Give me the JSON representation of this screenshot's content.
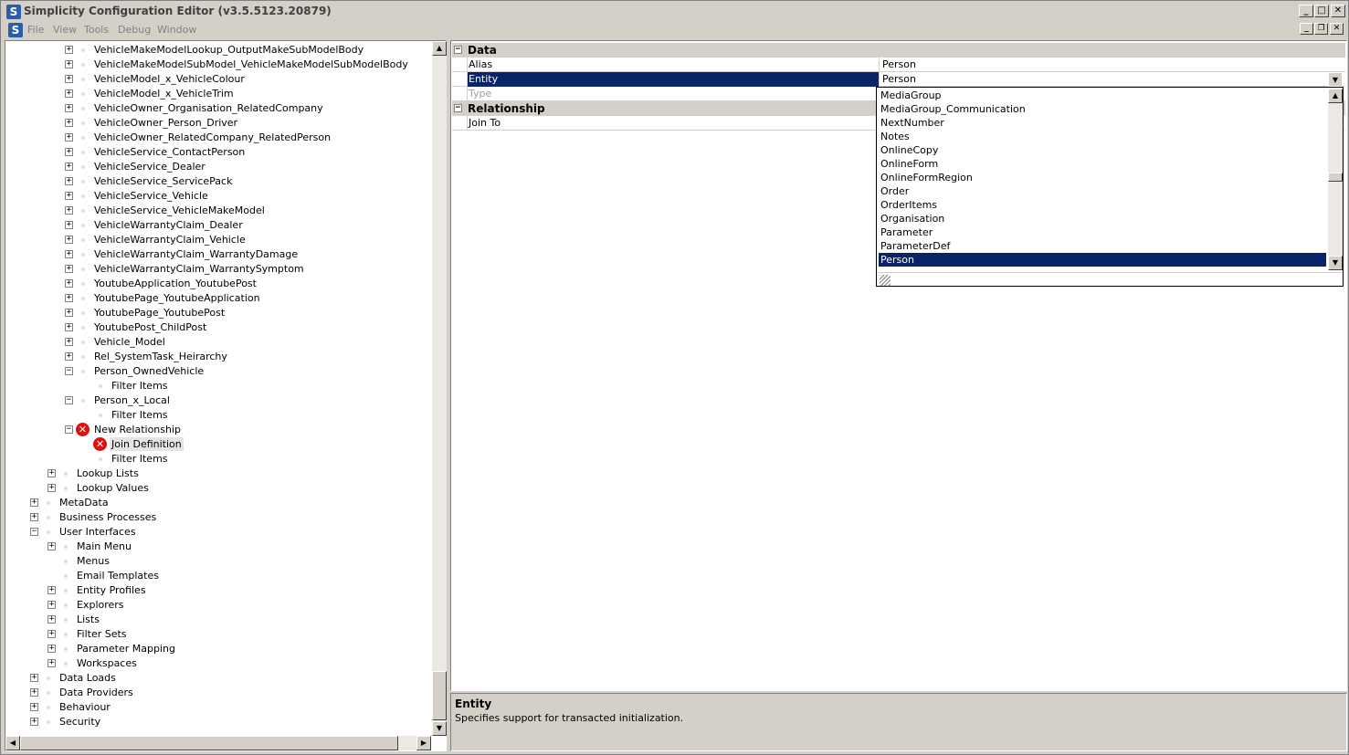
{
  "window": {
    "title": "Simplicity Configuration Editor (v3.5.5123.20879)",
    "app_icon_letter": "S"
  },
  "menu": {
    "items": [
      "File",
      "View",
      "Tools",
      "Debug",
      "Window"
    ]
  },
  "tree": {
    "nodes": [
      {
        "label": "VehicleMakeModelLookup_OutputMakeSubModelBody",
        "level": 3,
        "expander": "+",
        "icon": "dot"
      },
      {
        "label": "VehicleMakeModelSubModel_VehicleMakeModelSubModelBody",
        "level": 3,
        "expander": "+",
        "icon": "dot"
      },
      {
        "label": "VehicleModel_x_VehicleColour",
        "level": 3,
        "expander": "+",
        "icon": "dot"
      },
      {
        "label": "VehicleModel_x_VehicleTrim",
        "level": 3,
        "expander": "+",
        "icon": "dot"
      },
      {
        "label": "VehicleOwner_Organisation_RelatedCompany",
        "level": 3,
        "expander": "+",
        "icon": "dot"
      },
      {
        "label": "VehicleOwner_Person_Driver",
        "level": 3,
        "expander": "+",
        "icon": "dot"
      },
      {
        "label": "VehicleOwner_RelatedCompany_RelatedPerson",
        "level": 3,
        "expander": "+",
        "icon": "dot"
      },
      {
        "label": "VehicleService_ContactPerson",
        "level": 3,
        "expander": "+",
        "icon": "dot"
      },
      {
        "label": "VehicleService_Dealer",
        "level": 3,
        "expander": "+",
        "icon": "dot"
      },
      {
        "label": "VehicleService_ServicePack",
        "level": 3,
        "expander": "+",
        "icon": "dot"
      },
      {
        "label": "VehicleService_Vehicle",
        "level": 3,
        "expander": "+",
        "icon": "dot"
      },
      {
        "label": "VehicleService_VehicleMakeModel",
        "level": 3,
        "expander": "+",
        "icon": "dot"
      },
      {
        "label": "VehicleWarrantyClaim_Dealer",
        "level": 3,
        "expander": "+",
        "icon": "dot"
      },
      {
        "label": "VehicleWarrantyClaim_Vehicle",
        "level": 3,
        "expander": "+",
        "icon": "dot"
      },
      {
        "label": "VehicleWarrantyClaim_WarrantyDamage",
        "level": 3,
        "expander": "+",
        "icon": "dot"
      },
      {
        "label": "VehicleWarrantyClaim_WarrantySymptom",
        "level": 3,
        "expander": "+",
        "icon": "dot"
      },
      {
        "label": "YoutubeApplication_YoutubePost",
        "level": 3,
        "expander": "+",
        "icon": "dot"
      },
      {
        "label": "YoutubePage_YoutubeApplication",
        "level": 3,
        "expander": "+",
        "icon": "dot"
      },
      {
        "label": "YoutubePage_YoutubePost",
        "level": 3,
        "expander": "+",
        "icon": "dot"
      },
      {
        "label": "YoutubePost_ChildPost",
        "level": 3,
        "expander": "+",
        "icon": "dot"
      },
      {
        "label": "Vehicle_Model",
        "level": 3,
        "expander": "+",
        "icon": "dot"
      },
      {
        "label": "Rel_SystemTask_Heirarchy",
        "level": 3,
        "expander": "+",
        "icon": "dot"
      },
      {
        "label": "Person_OwnedVehicle",
        "level": 3,
        "expander": "-",
        "icon": "dot"
      },
      {
        "label": "Filter Items",
        "level": 4,
        "expander": "",
        "icon": "dot"
      },
      {
        "label": "Person_x_Local",
        "level": 3,
        "expander": "-",
        "icon": "dot"
      },
      {
        "label": "Filter Items",
        "level": 4,
        "expander": "",
        "icon": "dot"
      },
      {
        "label": "New Relationship",
        "level": 3,
        "expander": "-",
        "icon": "error"
      },
      {
        "label": "Join Definition",
        "level": 4,
        "expander": "",
        "icon": "error",
        "selected": true
      },
      {
        "label": "Filter Items",
        "level": 4,
        "expander": "",
        "icon": "dot"
      },
      {
        "label": "Lookup Lists",
        "level": 2,
        "expander": "+",
        "icon": "dot"
      },
      {
        "label": "Lookup Values",
        "level": 2,
        "expander": "+",
        "icon": "dot"
      },
      {
        "label": "MetaData",
        "level": 1,
        "expander": "+",
        "icon": "dot"
      },
      {
        "label": "Business Processes",
        "level": 1,
        "expander": "+",
        "icon": "dot"
      },
      {
        "label": "User Interfaces",
        "level": 1,
        "expander": "-",
        "icon": "dot"
      },
      {
        "label": "Main Menu",
        "level": 2,
        "expander": "+",
        "icon": "dot"
      },
      {
        "label": "Menus",
        "level": 2,
        "expander": "",
        "icon": "dot"
      },
      {
        "label": "Email Templates",
        "level": 2,
        "expander": "",
        "icon": "dot"
      },
      {
        "label": "Entity Profiles",
        "level": 2,
        "expander": "+",
        "icon": "dot"
      },
      {
        "label": "Explorers",
        "level": 2,
        "expander": "+",
        "icon": "dot"
      },
      {
        "label": "Lists",
        "level": 2,
        "expander": "+",
        "icon": "dot"
      },
      {
        "label": "Filter Sets",
        "level": 2,
        "expander": "+",
        "icon": "dot"
      },
      {
        "label": "Parameter Mapping",
        "level": 2,
        "expander": "+",
        "icon": "dot"
      },
      {
        "label": "Workspaces",
        "level": 2,
        "expander": "+",
        "icon": "dot"
      },
      {
        "label": "Data Loads",
        "level": 1,
        "expander": "+",
        "icon": "dot"
      },
      {
        "label": "Data Providers",
        "level": 1,
        "expander": "+",
        "icon": "dot"
      },
      {
        "label": "Behaviour",
        "level": 1,
        "expander": "+",
        "icon": "dot"
      },
      {
        "label": "Security",
        "level": 1,
        "expander": "+",
        "icon": "dot"
      }
    ]
  },
  "properties": {
    "categories": {
      "data": "Data",
      "relationship": "Relationship"
    },
    "rows": {
      "alias": {
        "name": "Alias",
        "value": "Person"
      },
      "entity": {
        "name": "Entity",
        "value": "Person"
      },
      "type": {
        "name": "Type",
        "value": ""
      },
      "join_to": {
        "name": "Join To",
        "value": ""
      }
    },
    "dropdown": {
      "items": [
        "MediaGroup",
        "MediaGroup_Communication",
        "NextNumber",
        "Notes",
        "OnlineCopy",
        "OnlineForm",
        "OnlineFormRegion",
        "Order",
        "OrderItems",
        "Organisation",
        "Parameter",
        "ParameterDef",
        "Person"
      ],
      "selected": "Person"
    }
  },
  "description": {
    "title": "Entity",
    "text": "Specifies support for transacted initialization."
  }
}
